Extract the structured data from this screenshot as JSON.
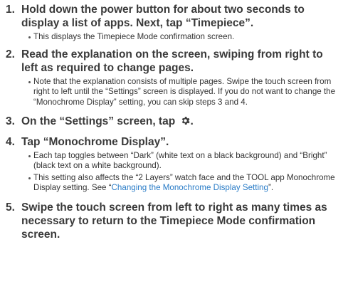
{
  "steps": [
    {
      "num": "1.",
      "title": "Hold down the power button for about two seconds to display a list of apps. Next, tap “Timepiece”.",
      "bullets": [
        "This displays the Timepiece Mode confirmation screen."
      ]
    },
    {
      "num": "2.",
      "title": "Read the explanation on the screen, swiping from right to left as required to change pages.",
      "bullets": [
        "Note that the explanation consists of multiple pages. Swipe the touch screen from right to left until the “Settings” screen is displayed. If you do not want to change the “Monochrome Display” setting, you can skip steps 3 and 4."
      ]
    },
    {
      "num": "3.",
      "title_before_icon": "On the “Settings” screen, tap",
      "title_after_icon": ".",
      "icon": "gear-icon"
    },
    {
      "num": "4.",
      "title": "Tap “Monochrome Display”.",
      "bullets": [
        "Each tap toggles between “Dark” (white text on a black background) and “Bright” (black text on a white background)."
      ],
      "bullet2_text": "This setting also affects the “2 Layers” watch face and the TOOL app Monochrome Display setting. See “",
      "bullet2_link": "Changing the Monochrome Display Setting",
      "bullet2_end": "”."
    },
    {
      "num": "5.",
      "title": "Swipe the touch screen from left to right as many times as necessary to return to the Timepiece Mode confirmation screen."
    }
  ],
  "colors": {
    "text": "#3a3a3a",
    "link": "#2a7cc7"
  }
}
